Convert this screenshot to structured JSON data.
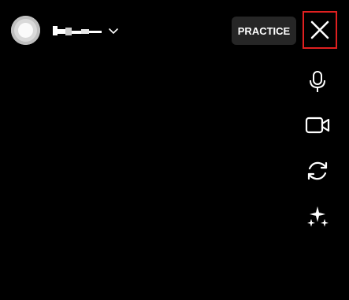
{
  "header": {
    "practice_label": "PRACTICE"
  },
  "icons": {
    "avatar": "user-avatar",
    "account_switch": "chevron-down-icon",
    "close": "close-icon",
    "mic": "microphone-icon",
    "camera": "video-camera-icon",
    "flip": "flip-camera-icon",
    "effects": "sparkles-effects-icon"
  },
  "colors": {
    "background": "#000000",
    "practice_bg": "#262626",
    "close_highlight": "#e02020",
    "icon": "#ffffff"
  }
}
